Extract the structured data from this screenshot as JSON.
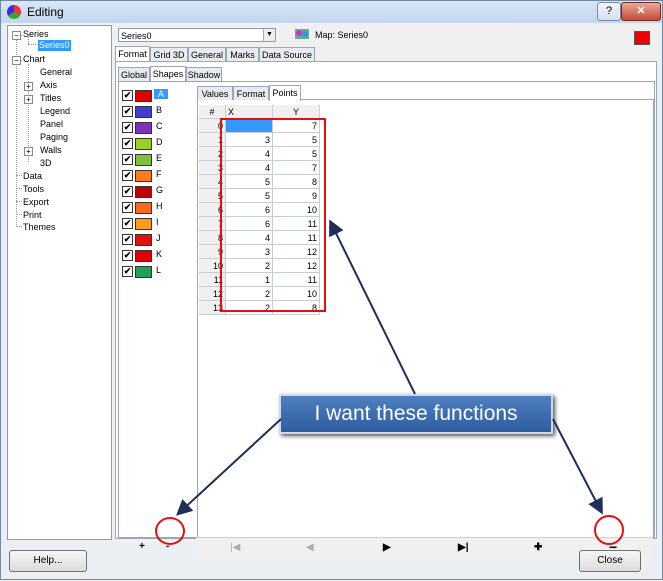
{
  "window": {
    "title": "Editing",
    "help_glyph": "?",
    "close_glyph": "✕"
  },
  "tree": {
    "items": [
      {
        "label": "Series"
      },
      {
        "label": "Series0"
      },
      {
        "label": "Chart"
      },
      {
        "label": "General"
      },
      {
        "label": "Axis"
      },
      {
        "label": "Titles"
      },
      {
        "label": "Legend"
      },
      {
        "label": "Panel"
      },
      {
        "label": "Paging"
      },
      {
        "label": "Walls"
      },
      {
        "label": "3D"
      },
      {
        "label": "Data"
      },
      {
        "label": "Tools"
      },
      {
        "label": "Export"
      },
      {
        "label": "Print"
      },
      {
        "label": "Themes"
      }
    ]
  },
  "series_combo": {
    "value": "Series0",
    "arrow": "▼"
  },
  "map": {
    "label": "Map: Series0"
  },
  "colors": {
    "series_color": "#e00000",
    "highlight": "#e01010",
    "selection": "#3399ff",
    "callout": "#2e5da0"
  },
  "tabs_main": [
    "Format",
    "Grid 3D",
    "General",
    "Marks",
    "Data Source"
  ],
  "tabs_format": [
    "Global",
    "Shapes",
    "Shadow"
  ],
  "tabs_shapes": [
    "Values",
    "Format",
    "Points"
  ],
  "series_list": [
    {
      "name": "A",
      "color": "#e00000",
      "checked": "✔"
    },
    {
      "name": "B",
      "color": "#4040d0",
      "checked": "✔"
    },
    {
      "name": "C",
      "color": "#8030c0",
      "checked": "✔"
    },
    {
      "name": "D",
      "color": "#a0d020",
      "checked": "✔"
    },
    {
      "name": "E",
      "color": "#80c040",
      "checked": "✔"
    },
    {
      "name": "F",
      "color": "#ff7a1a",
      "checked": "✔"
    },
    {
      "name": "G",
      "color": "#c00000",
      "checked": "✔"
    },
    {
      "name": "H",
      "color": "#ff6a1a",
      "checked": "✔"
    },
    {
      "name": "I",
      "color": "#ff9a1a",
      "checked": "✔"
    },
    {
      "name": "J",
      "color": "#e01010",
      "checked": "✔"
    },
    {
      "name": "K",
      "color": "#e00000",
      "checked": "✔"
    },
    {
      "name": "L",
      "color": "#20a050",
      "checked": "✔"
    }
  ],
  "grid": {
    "headers": [
      "#",
      "X",
      "Y"
    ],
    "rows": [
      [
        "0",
        "1",
        "7"
      ],
      [
        "1",
        "3",
        "5"
      ],
      [
        "2",
        "4",
        "5"
      ],
      [
        "3",
        "4",
        "7"
      ],
      [
        "4",
        "5",
        "8"
      ],
      [
        "5",
        "5",
        "9"
      ],
      [
        "6",
        "6",
        "10"
      ],
      [
        "7",
        "6",
        "11"
      ],
      [
        "8",
        "4",
        "11"
      ],
      [
        "9",
        "3",
        "12"
      ],
      [
        "10",
        "2",
        "12"
      ],
      [
        "11",
        "1",
        "11"
      ],
      [
        "12",
        "2",
        "10"
      ],
      [
        "13",
        "2",
        "8"
      ]
    ]
  },
  "nav": {
    "first": "|◀",
    "prev": "◀",
    "next": "▶",
    "last": "▶|",
    "add": "✚",
    "remove": "−"
  },
  "left_buttons": {
    "add": "+",
    "remove": "-"
  },
  "callout": {
    "text": "I want these functions"
  },
  "footer": {
    "help": "Help...",
    "close": "Close"
  }
}
